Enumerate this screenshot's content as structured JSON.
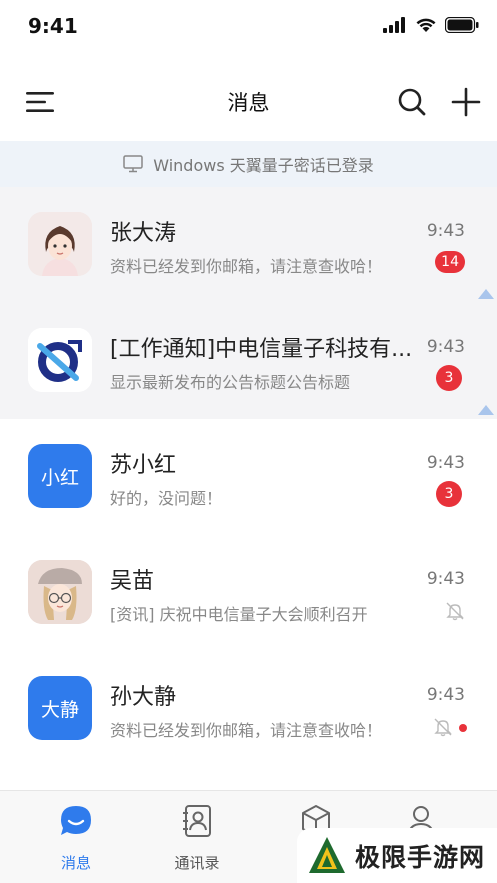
{
  "status_bar": {
    "time": "9:41"
  },
  "header": {
    "title": "消息"
  },
  "login_banner": {
    "text": "Windows 天翼量子密话已登录"
  },
  "chats": [
    {
      "name": "张大涛",
      "preview": "资料已经发到你邮箱，请注意查收哈！",
      "time": "9:43",
      "unread": "14",
      "pinned": true
    },
    {
      "name": "[工作通知]中电信量子科技有...",
      "preview": "显示最新发布的公告标题公告标题",
      "time": "9:43",
      "unread": "3",
      "pinned": true
    },
    {
      "name": "苏小红",
      "avatar_text": "小红",
      "preview": "好的，没问题！",
      "time": "9:43",
      "unread": "3"
    },
    {
      "name": "吴苗",
      "preview": "[资讯] 庆祝中电信量子大会顺利召开",
      "time": "9:43",
      "muted": true
    },
    {
      "name": "孙大静",
      "avatar_text": "大静",
      "preview": "资料已经发到你邮箱，请注意查收哈！",
      "time": "9:43",
      "muted": true,
      "has_dot": true
    }
  ],
  "tabs": [
    {
      "label": "消息",
      "active": true,
      "icon": "chat-bubble-icon"
    },
    {
      "label": "通讯录",
      "icon": "contacts-icon"
    },
    {
      "label": "",
      "icon": "cube-icon"
    },
    {
      "label": "",
      "icon": "person-icon"
    }
  ],
  "watermark": {
    "text": "极限手游网"
  },
  "colors": {
    "accent": "#2f7bec",
    "badge": "#e8323a",
    "banner_bg": "#eef3f9",
    "pinned_bg": "#f4f4f6"
  }
}
